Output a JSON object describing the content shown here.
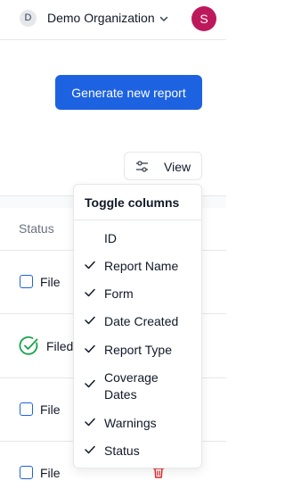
{
  "org": {
    "initial": "D",
    "name": "Demo Organization"
  },
  "user": {
    "initial": "S"
  },
  "actions": {
    "generate_label": "Generate new report",
    "view_label": "View"
  },
  "table": {
    "status_header": "Status",
    "rows": [
      {
        "status_text": "File"
      },
      {
        "status_text": "Filed"
      },
      {
        "status_text": "File"
      },
      {
        "status_text": "File"
      }
    ]
  },
  "menu": {
    "title": "Toggle columns",
    "items": [
      {
        "label": "ID",
        "checked": false
      },
      {
        "label": "Report Name",
        "checked": true
      },
      {
        "label": "Form",
        "checked": true
      },
      {
        "label": "Date Created",
        "checked": true
      },
      {
        "label": "Report Type",
        "checked": true
      },
      {
        "label": "Coverage",
        "label2": "Dates",
        "checked": true
      },
      {
        "label": "Warnings",
        "checked": true
      },
      {
        "label": "Status",
        "checked": true
      }
    ]
  },
  "colors": {
    "primary": "#1d62e0",
    "avatar": "#be185d",
    "success": "#16a34a",
    "danger": "#dc2626"
  }
}
